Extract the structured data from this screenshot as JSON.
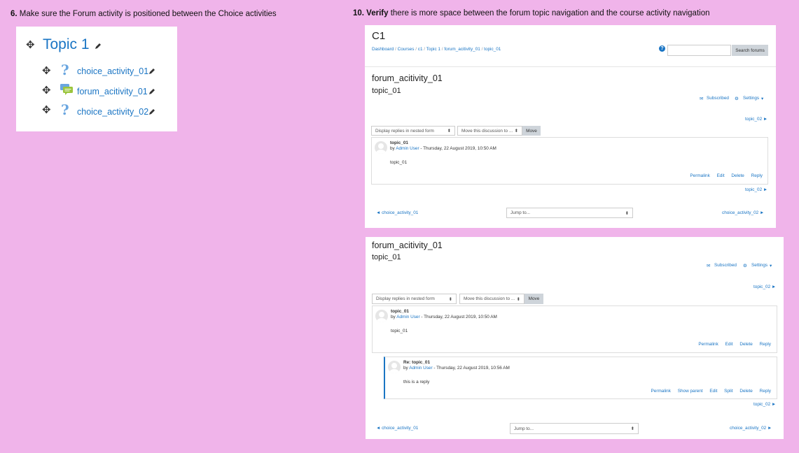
{
  "step6": {
    "num": "6.",
    "text": " Make sure the Forum activity is positioned between the Choice activities"
  },
  "step10": {
    "num": "10. Verify",
    "text": " there is more space between the forum topic navigation and the course activity navigation"
  },
  "topic_panel": {
    "title": "Topic 1",
    "activities": [
      {
        "name": "choice_activity_01",
        "icon": "question-icon"
      },
      {
        "name": "forum_acitivity_01",
        "icon": "forum-icon"
      },
      {
        "name": "choice_activity_02",
        "icon": "question-icon"
      }
    ]
  },
  "shot1": {
    "course": "C1",
    "breadcrumb": [
      "Dashboard",
      "Courses",
      "c1",
      "Topic 1",
      "forum_acitivity_01",
      "topic_01"
    ],
    "search_button": "Search forums",
    "forum_title": "forum_acitivity_01",
    "discussion_title": "topic_01",
    "subscribed": "Subscribed",
    "settings": "Settings",
    "next_top": "topic_02 ►",
    "display_mode": "Display replies in nested form",
    "move_select": "Move this discussion to ...",
    "move_button": "Move",
    "post": {
      "subject": "topic_01",
      "by": "by",
      "author": "Admin User",
      "date": " - Thursday, 22 August 2019, 10:50 AM",
      "body": "topic_01",
      "actions": [
        "Permalink",
        "Edit",
        "Delete",
        "Reply"
      ]
    },
    "next_bottom": "topic_02 ►",
    "prev_activity": "◄ choice_activity_01",
    "jump_to": "Jump to...",
    "next_activity": "choice_activity_02 ►"
  },
  "shot2": {
    "forum_title": "forum_acitivity_01",
    "discussion_title": "topic_01",
    "subscribed": "Subscribed",
    "settings": "Settings",
    "next_top": "topic_02 ►",
    "display_mode": "Display replies in nested form",
    "move_select": "Move this discussion to ...",
    "move_button": "Move",
    "post": {
      "subject": "topic_01",
      "by": "by",
      "author": "Admin User",
      "date": " - Thursday, 22 August 2019, 10:50 AM",
      "body": "topic_01",
      "actions": [
        "Permalink",
        "Edit",
        "Delete",
        "Reply"
      ]
    },
    "reply": {
      "subject": "Re: topic_01",
      "by": "by",
      "author": "Admin User",
      "date": " - Thursday, 22 August 2019, 10:56 AM",
      "body": "this is a reply",
      "actions": [
        "Permalink",
        "Show parent",
        "Edit",
        "Split",
        "Delete",
        "Reply"
      ]
    },
    "next_bottom": "topic_02 ►",
    "prev_activity": "◄ choice_activity_01",
    "jump_to": "Jump to...",
    "next_activity": "choice_activity_02 ►"
  },
  "colors": {
    "background": "#f0b4ea",
    "link": "#1a75c4",
    "reply_border": "#1a75c4"
  }
}
